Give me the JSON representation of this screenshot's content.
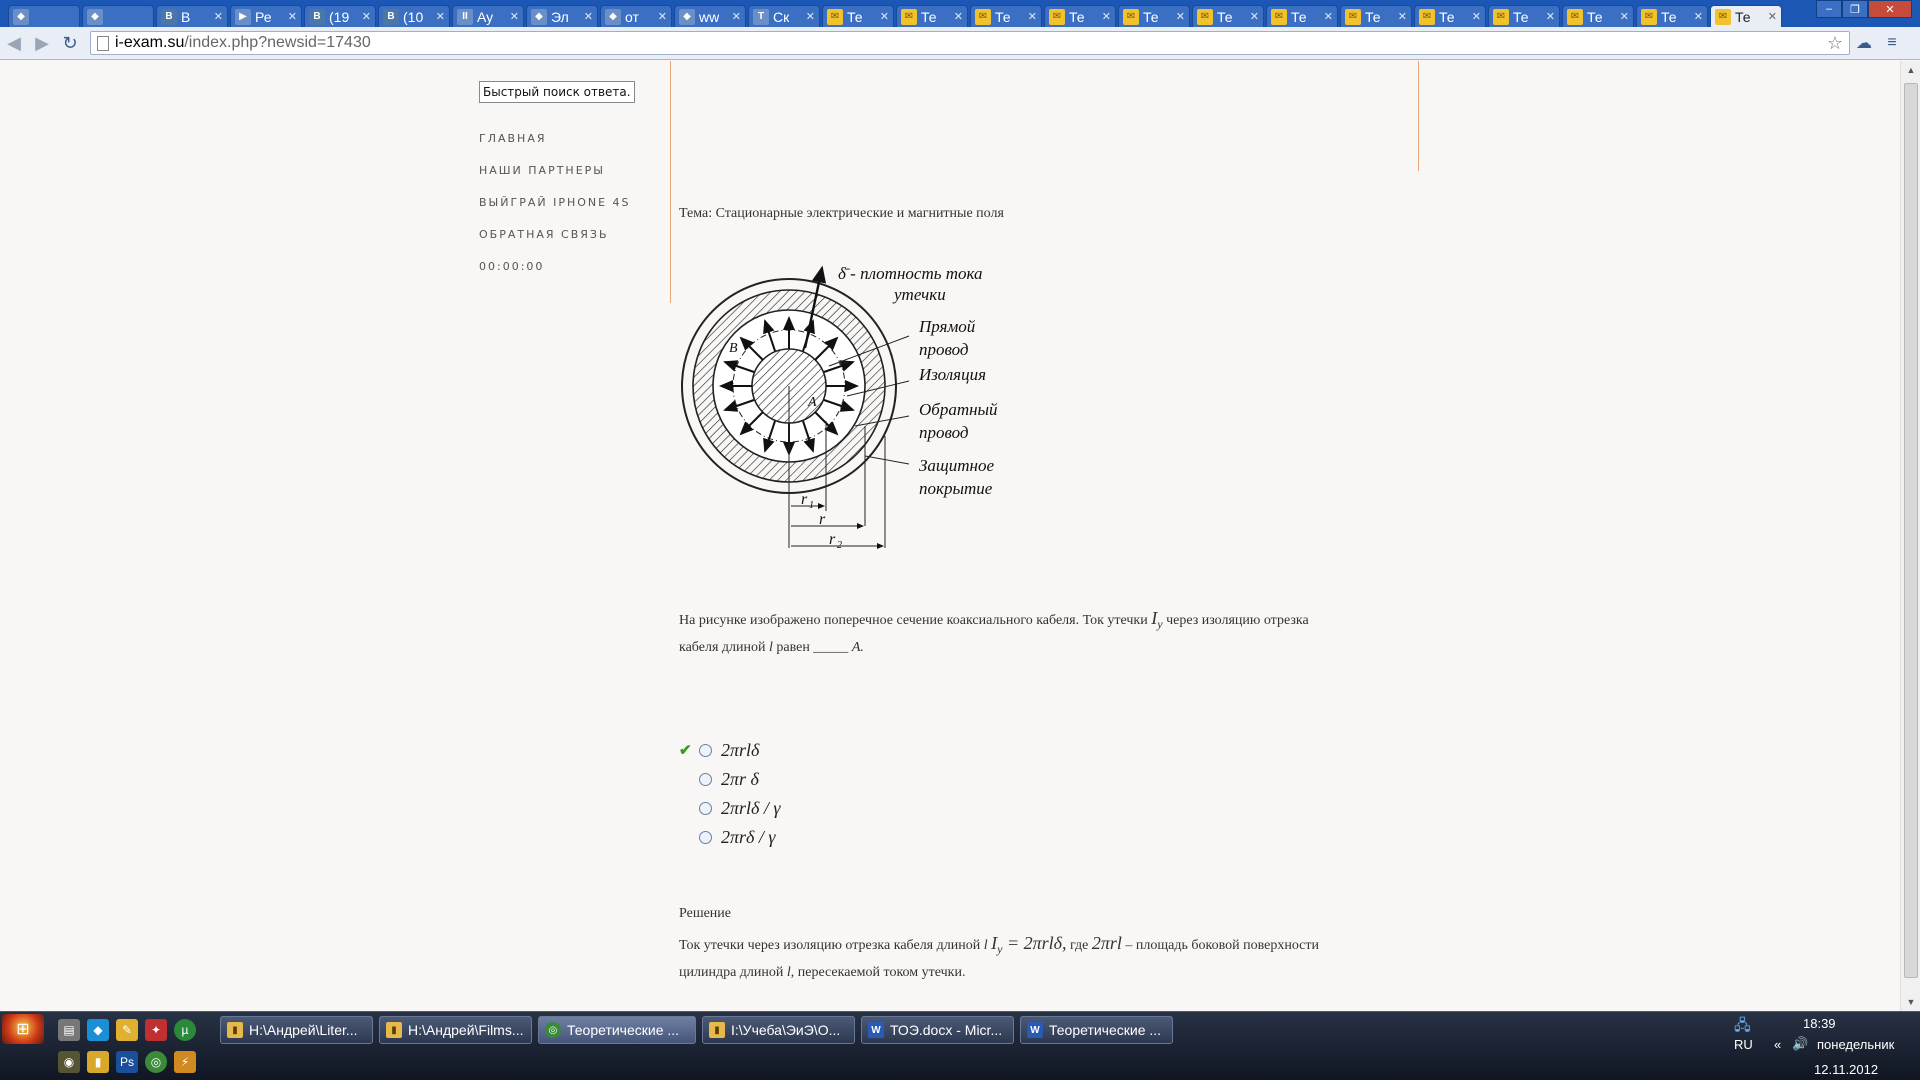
{
  "browser": {
    "tabs": [
      {
        "label": "",
        "icon": "chrome-ext-icon"
      },
      {
        "label": "",
        "icon": "app-icon"
      },
      {
        "label": "В",
        "icon": "vk-icon"
      },
      {
        "label": "Ре",
        "icon": "play-icon"
      },
      {
        "label": "(19",
        "icon": "vk-icon"
      },
      {
        "label": "(10",
        "icon": "vk-icon"
      },
      {
        "label": "Ау",
        "icon": "pause-icon"
      },
      {
        "label": "Эл",
        "icon": "app-icon"
      },
      {
        "label": "от",
        "icon": "yandex-icon"
      },
      {
        "label": "ww",
        "icon": "doc-icon"
      },
      {
        "label": "Ск",
        "icon": "t-icon"
      },
      {
        "label": "Те",
        "icon": "envelope-icon"
      },
      {
        "label": "Те",
        "icon": "envelope-icon"
      },
      {
        "label": "Те",
        "icon": "envelope-icon"
      },
      {
        "label": "Те",
        "icon": "envelope-icon"
      },
      {
        "label": "Те",
        "icon": "envelope-icon"
      },
      {
        "label": "Те",
        "icon": "envelope-icon"
      },
      {
        "label": "Те",
        "icon": "envelope-icon"
      },
      {
        "label": "Те",
        "icon": "envelope-icon"
      },
      {
        "label": "Те",
        "icon": "envelope-icon"
      },
      {
        "label": "Те",
        "icon": "envelope-icon"
      },
      {
        "label": "Те",
        "icon": "envelope-icon"
      },
      {
        "label": "Те",
        "icon": "envelope-icon"
      },
      {
        "label": "Те",
        "icon": "envelope-icon"
      }
    ],
    "url_host": "i-exam.su",
    "url_path": "/index.php?newsid=17430"
  },
  "sidebar": {
    "search_value": "Быстрый поиск ответа...",
    "nav": [
      {
        "label": "ГЛАВНАЯ"
      },
      {
        "label": "НАШИ ПАРТНЕРЫ"
      },
      {
        "label": "ВЫЙГРАЙ IPHONE 4S"
      },
      {
        "label": "ОБРАТНАЯ СВЯЗЬ"
      },
      {
        "label": "00:00:00"
      }
    ]
  },
  "content": {
    "topic": "Тема: Стационарные электрические и магнитные поля",
    "figure": {
      "delta_label": "δ̄ - плотность тока",
      "delta_label2": "утечки",
      "label_direct1": "Прямой",
      "label_direct2": "провод",
      "label_insulation": "Изоляция",
      "label_return1": "Обратный",
      "label_return2": "провод",
      "label_cover1": "Защитное",
      "label_cover2": "покрытие",
      "label_B": "B",
      "label_A": "A",
      "label_r1": "r",
      "label_r1_sub": "1",
      "label_r": "r",
      "label_r2": "r",
      "label_r2_sub": "2"
    },
    "question_part1": "На рисунке изображено поперечное сечение коаксиального кабеля. Ток утечки ",
    "question_formula": "I",
    "question_formula_sub": "y",
    "question_part2": " через изоляцию отрезка",
    "question_part3": "кабеля длиной ",
    "question_l": "l",
    "question_part4": " равен _____ ",
    "question_unit": "А.",
    "answers": [
      {
        "text": "2πrlδ",
        "correct": true
      },
      {
        "text": "2πr δ",
        "correct": false
      },
      {
        "text": "2πrlδ / γ",
        "correct": false
      },
      {
        "text": "2πrδ / γ",
        "correct": false
      }
    ],
    "solution_title": "Решение",
    "solution_part1": "Ток утечки через изоляцию отрезка кабеля длиной ",
    "solution_l": "l",
    "solution_formula": "I",
    "solution_formula_sub": "y",
    "solution_formula_rest": " = 2πrlδ,",
    "solution_part2": " где ",
    "solution_formula2": "2πrl",
    "solution_part3": " – площадь боковой поверхности",
    "solution_part4": "цилиндра длиной ",
    "solution_l2": "l",
    "solution_part5": ", пересекаемой током утечки."
  },
  "taskbar": {
    "tasks": [
      {
        "label": "H:\\Андрей\\Liter...",
        "icon": "folder-icon"
      },
      {
        "label": "H:\\Андрей\\Films...",
        "icon": "folder-icon"
      },
      {
        "label": "Теоретические ...",
        "icon": "chrome-icon"
      },
      {
        "label": "I:\\Учеба\\ЭиЭ\\О...",
        "icon": "folder-icon"
      },
      {
        "label": "ТОЭ.docx - Micr...",
        "icon": "word-icon"
      },
      {
        "label": "Теоретические ...",
        "icon": "word-icon"
      }
    ],
    "tray": {
      "language": "RU",
      "time": "18:39",
      "day": "понедельник",
      "date": "12.11.2012"
    }
  }
}
